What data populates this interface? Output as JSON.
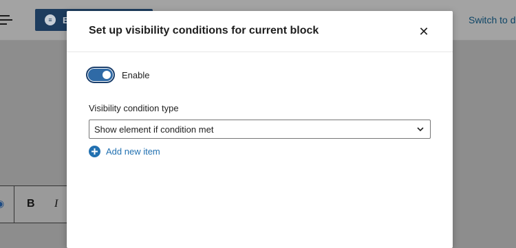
{
  "background": {
    "editor_button_label": "E",
    "switch_link": "Switch to d",
    "format_bar": {
      "bold": "B",
      "italic": "I"
    }
  },
  "modal": {
    "title": "Set up visibility conditions for current block",
    "close_icon": "close-icon",
    "toggle": {
      "label": "Enable",
      "checked": true
    },
    "condition_type": {
      "label": "Visibility condition type",
      "selected": "Show element if condition met"
    },
    "add_item": {
      "label": "Add new item",
      "icon": "plus-circle-icon"
    }
  },
  "colors": {
    "accent": "#2271b1",
    "toggle_on": "#2f6aa6",
    "editor_button": "#1d3c5e",
    "overlay": "#8d8d8d"
  }
}
